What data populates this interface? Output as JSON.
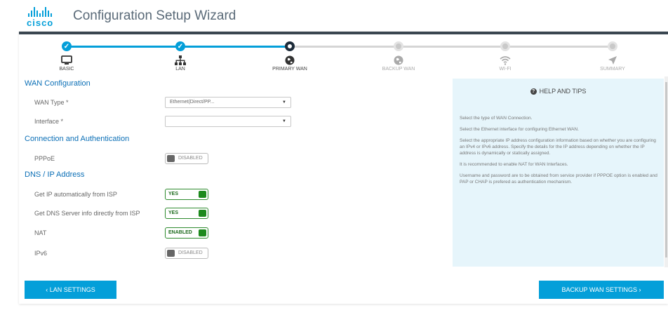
{
  "header": {
    "logo_text": "cisco",
    "title": "Configuration Setup Wizard"
  },
  "steps": [
    {
      "label": "BASIC",
      "state": "done",
      "icon": "monitor-icon"
    },
    {
      "label": "LAN",
      "state": "done",
      "icon": "network-icon"
    },
    {
      "label": "PRIMARY WAN",
      "state": "current",
      "icon": "globe-icon"
    },
    {
      "label": "BACKUP WAN",
      "state": "todo",
      "icon": "globe-icon"
    },
    {
      "label": "WI-FI",
      "state": "todo",
      "icon": "wifi-icon"
    },
    {
      "label": "SUMMARY",
      "state": "todo",
      "icon": "send-icon"
    }
  ],
  "wan": {
    "section_title": "WAN Configuration",
    "wan_type_label": "WAN Type *",
    "wan_type_value": "Ethernet(Direct/PP...",
    "interface_label": "Interface *",
    "interface_value": ""
  },
  "auth": {
    "section_title": "Connection and Authentication",
    "pppoe_label": "PPPoE",
    "pppoe_state": "DISABLED"
  },
  "dns": {
    "section_title": "DNS / IP Address",
    "get_ip_label": "Get IP automatically from ISP",
    "get_ip_state": "YES",
    "get_dns_label": "Get DNS Server info directly from ISP",
    "get_dns_state": "YES",
    "nat_label": "NAT",
    "nat_state": "ENABLED",
    "ipv6_label": "IPv6",
    "ipv6_state": "DISABLED"
  },
  "help": {
    "title": "HELP AND TIPS",
    "tips": [
      "Select the type of WAN Connection.",
      "Select the Ethernet interface for configuring Ethernet WAN.",
      "Select the appropriate IP address configuration information based on whether you are configuring an IPv4 or IPv6 address. Specify the details for the IP address depending on whether the IP address is dynamically or statically assigned.",
      "It is recommended to enable NAT for WAN Interfaces.",
      "Username and password are to be obtained from service provider if PPPOE option is enabled and PAP or CHAP is prefered as authentication mechanism."
    ]
  },
  "nav": {
    "back_label": "‹ LAN SETTINGS",
    "next_label": "BACKUP WAN SETTINGS ›"
  },
  "colors": {
    "accent": "#049fd9",
    "dark": "#1d2b3a",
    "section": "#0b6fb6",
    "toggle_on": "#1d8a1d",
    "help_bg": "#e6f5fb"
  }
}
